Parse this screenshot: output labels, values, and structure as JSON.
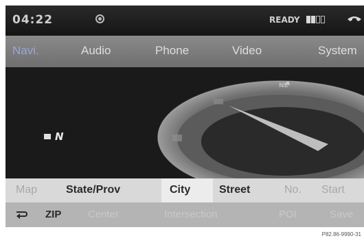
{
  "status": {
    "time": "04:22",
    "ready": "READY",
    "signal_bars": 4,
    "signal_filled": 2
  },
  "menu": {
    "items": [
      {
        "label": "Navi.",
        "active": true
      },
      {
        "label": "Audio"
      },
      {
        "label": "Phone"
      },
      {
        "label": "Video"
      },
      {
        "label": "System"
      }
    ]
  },
  "map": {
    "heading_label": "NE",
    "compass_n": "N"
  },
  "tabs": {
    "items": [
      "Map",
      "State/Prov",
      "City",
      "Street",
      "No.",
      "Start"
    ],
    "selected": "City"
  },
  "subrow": {
    "items": [
      "ZIP",
      "Center",
      "Intersection",
      "POI",
      "Save"
    ]
  },
  "reference": "P82.86-9990-31",
  "colors": {
    "active_menu": "#9aa7d8",
    "map_bg": "#1a1a1a",
    "compass_ring": "#8e8e8e"
  }
}
